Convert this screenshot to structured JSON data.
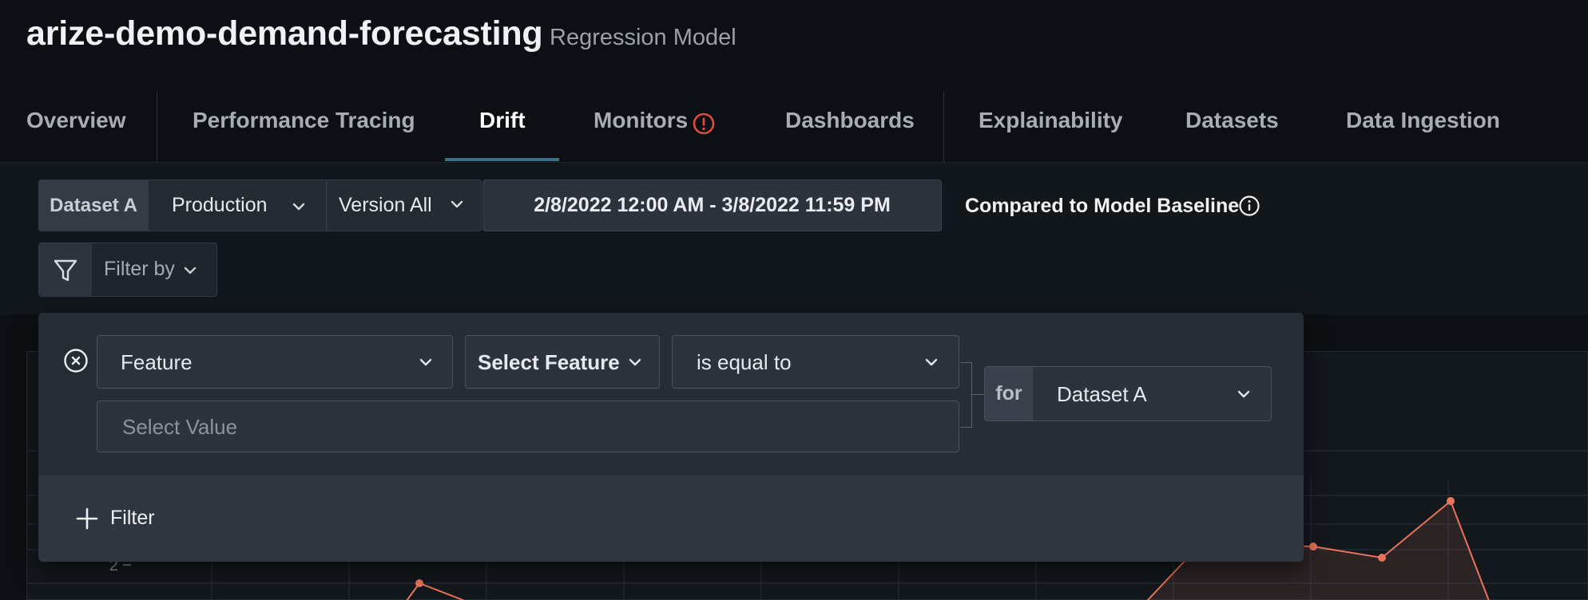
{
  "header": {
    "model_title": "arize-demo-demand-forecasting",
    "model_type": "Regression Model"
  },
  "tabs": [
    {
      "label": "Overview",
      "active": false
    },
    {
      "label": "Performance Tracing",
      "active": false
    },
    {
      "label": "Drift",
      "active": true
    },
    {
      "label": "Monitors",
      "active": false,
      "alert": true
    },
    {
      "label": "Dashboards",
      "active": false
    },
    {
      "label": "Explainability",
      "active": false
    },
    {
      "label": "Datasets",
      "active": false
    },
    {
      "label": "Data Ingestion",
      "active": false
    }
  ],
  "toolbar": {
    "dataset_tag": "Dataset A",
    "environment": "Production",
    "version": "Version All",
    "date_range": "2/8/2022 12:00 AM - 3/8/2022 11:59 PM",
    "baseline_label": "Compared to Model Baseline",
    "filter_by": "Filter by"
  },
  "filter_popup": {
    "dimension_type": "Feature",
    "feature_select": "Select Feature",
    "operator": "is equal to",
    "value_placeholder": "Select Value",
    "for_label": "for",
    "dataset": "Dataset A",
    "add_filter_label": "Filter"
  },
  "chart": {
    "y_tick_visible": "2",
    "line_color": "#e8735a"
  },
  "colors": {
    "background": "#0c1014",
    "accent_underline": "#3a6f86",
    "alert": "#e04a3f"
  }
}
